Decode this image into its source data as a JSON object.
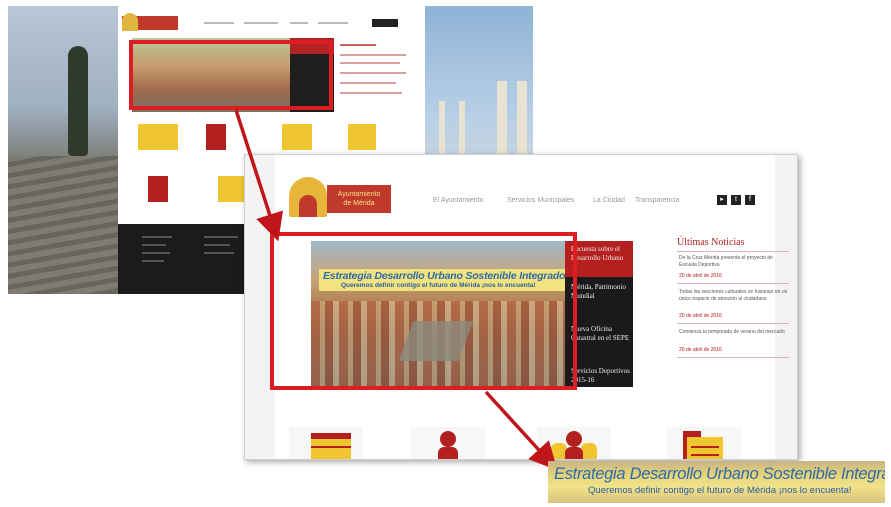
{
  "front": {
    "logo": {
      "line1": "Ayuntamiento",
      "line2": "de Mérida"
    },
    "nav": [
      "El Ayuntamiento",
      "Servicios Municipales",
      "La Ciudad",
      "Transparencia"
    ],
    "social": [
      "▸",
      "t",
      "f"
    ],
    "banner": {
      "title": "Estrategia Desarrollo Urbano Sostenible Integrado",
      "subtitle": "Queremos definir contigo el futuro de Mérida   ¡nos lo encuenta!"
    },
    "side_items": [
      "Encuesta sobre el Desarrollo Urbano",
      "Mérida, Patrimonio Mundial",
      "Nueva Oficina Catastral en el SEPE",
      "Servicios Deportivos 2015-16"
    ],
    "news": {
      "heading": "Últimas Noticias",
      "items": [
        {
          "text": "De la Cruz Mérida presenta el proyecto de Escuela Deportiva",
          "date": "20 de abril de 2016"
        },
        {
          "text": "Todas las secciones culturales se fusionan en un único espacio de atención al ciudadano",
          "date": "20 de abril de 2016"
        },
        {
          "text": "Comienza la temporada de verano del mercado",
          "date": "20 de abril de 2016"
        }
      ]
    }
  },
  "zoom": {
    "title": "Estrategia Desarrollo Urbano Sostenible Integrado",
    "subtitle": "Queremos definir contigo el futuro de Mérida   ¡nos lo encuenta!"
  },
  "colors": {
    "highlight": "#dc1e22",
    "brand_red": "#b3201f",
    "brand_gold": "#e6b53a"
  }
}
